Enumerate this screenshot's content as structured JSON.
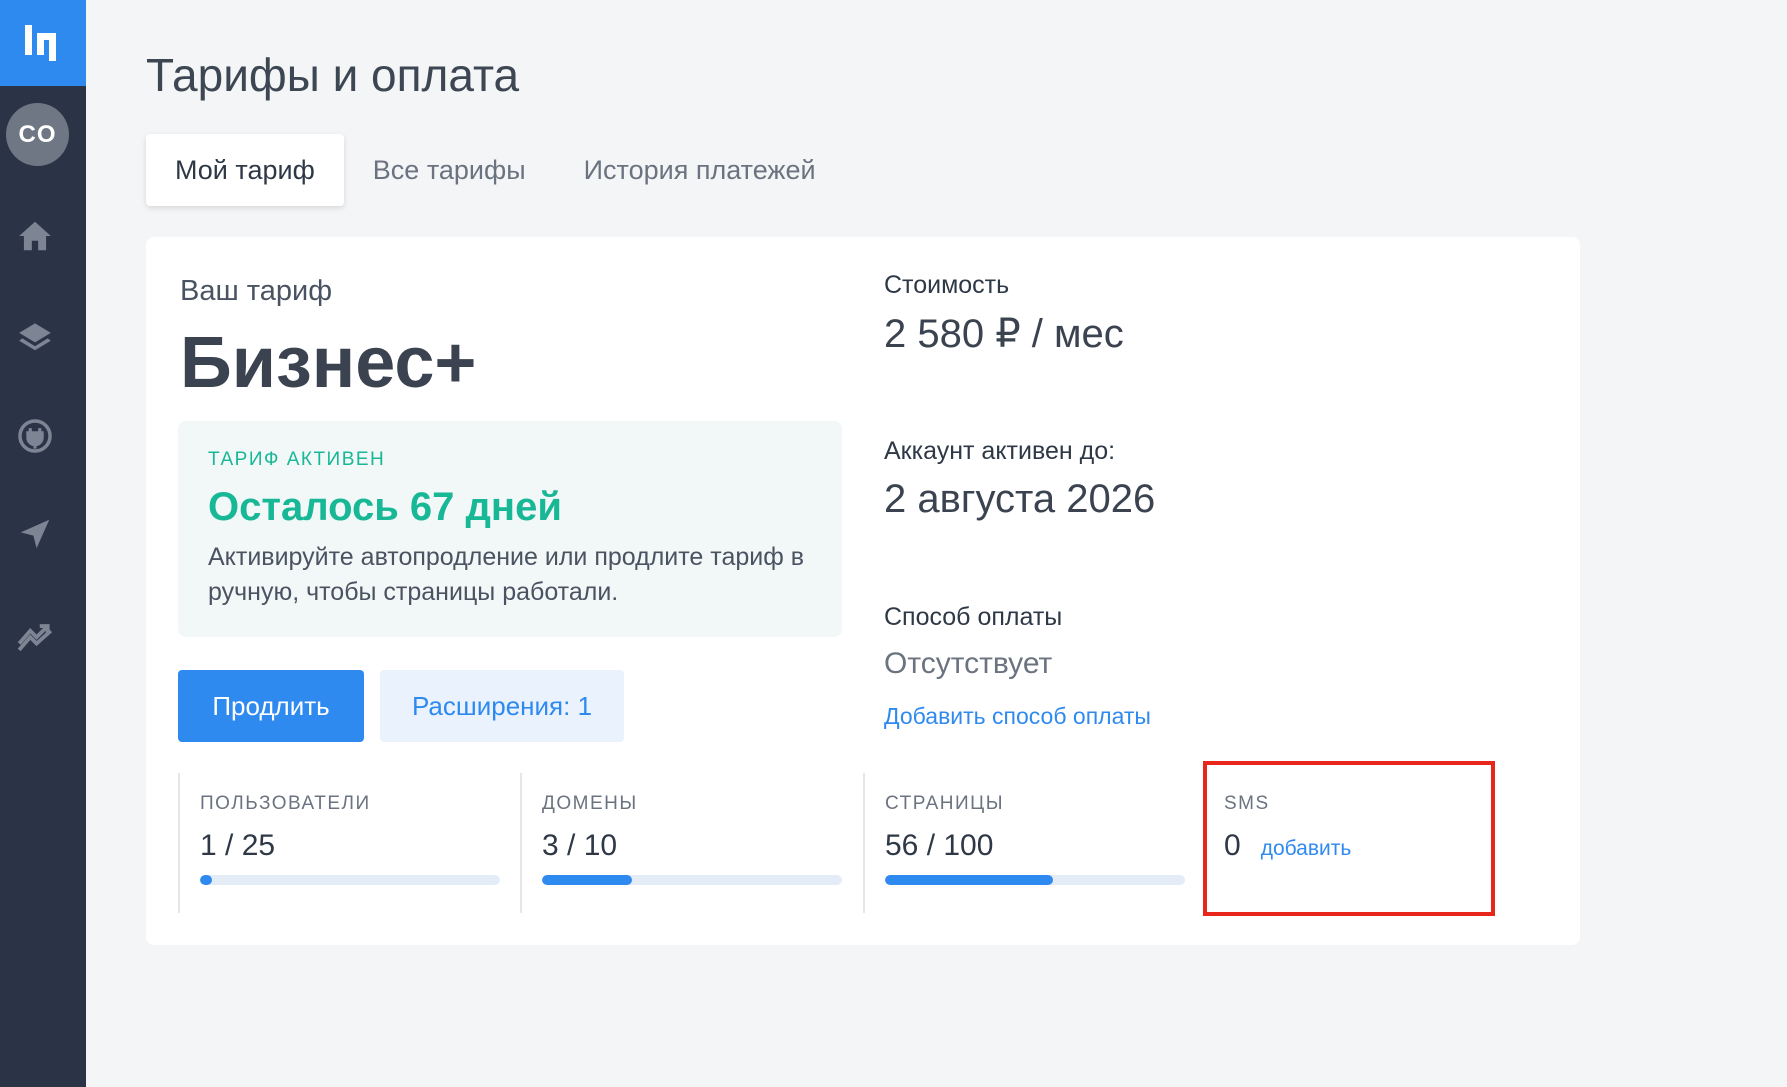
{
  "sidebar": {
    "avatar_initials": "CO",
    "icons": [
      "logo-icon",
      "home-icon",
      "layers-icon",
      "plugin-icon",
      "send-icon",
      "analytics-icon"
    ]
  },
  "page": {
    "title": "Тарифы и оплата"
  },
  "tabs": [
    {
      "label": "Мой тариф",
      "active": true
    },
    {
      "label": "Все тарифы",
      "active": false
    },
    {
      "label": "История платежей",
      "active": false
    }
  ],
  "plan": {
    "label": "Ваш тариф",
    "name": "Бизнес+",
    "status_title": "ТАРИФ АКТИВЕН",
    "days_left": "Осталось 67 дней",
    "description": "Активируйте автопродление или продлите тариф в ручную, чтобы страницы работали.",
    "renew_button": "Продлить",
    "extensions_button": "Расширения: 1"
  },
  "billing": {
    "cost_label": "Стоимость",
    "cost_value": "2 580 ₽ / мес",
    "active_until_label": "Аккаунт активен до:",
    "active_until_value": "2 августа 2026",
    "payment_method_label": "Способ оплаты",
    "payment_method_value": "Отсутствует",
    "add_payment_link": "Добавить способ оплаты"
  },
  "stats": [
    {
      "label": "ПОЛЬЗОВАТЕЛИ",
      "value": "1 / 25",
      "progress": 0.04
    },
    {
      "label": "ДОМЕНЫ",
      "value": "3 / 10",
      "progress": 0.3
    },
    {
      "label": "СТРАНИЦЫ",
      "value": "56 / 100",
      "progress": 0.56
    },
    {
      "label": "SMS",
      "value": "0",
      "add_link": "добавить"
    }
  ],
  "colors": {
    "accent": "#2f8af0",
    "success": "#18b796",
    "sidebar": "#2b3346",
    "highlight": "#e8261c"
  }
}
